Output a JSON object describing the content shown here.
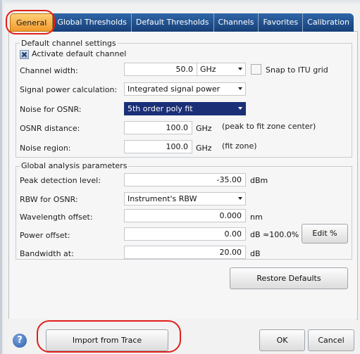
{
  "tabs": [
    {
      "label": "General"
    },
    {
      "label": "Global Thresholds"
    },
    {
      "label": "Default Thresholds"
    },
    {
      "label": "Channels"
    },
    {
      "label": "Favorites"
    },
    {
      "label": "Calibration"
    }
  ],
  "default_channel": {
    "title": "Default channel settings",
    "activate_label": "Activate default channel",
    "activate_checked": true,
    "channel_width": {
      "label": "Channel width:",
      "value": "50.0",
      "unit": "GHz"
    },
    "snap_label": "Snap to ITU grid",
    "snap_checked": false,
    "signal_power": {
      "label": "Signal power calculation:",
      "value": "Integrated signal power"
    },
    "noise_osnr": {
      "label": "Noise for OSNR:",
      "value": "5th order poly fit"
    },
    "osnr_distance": {
      "label": "OSNR distance:",
      "value": "100.0",
      "unit": "GHz",
      "note": "(peak to fit zone center)"
    },
    "noise_region": {
      "label": "Noise region:",
      "value": "100.0",
      "unit": "GHz",
      "note": "(fit zone)"
    }
  },
  "global_analysis": {
    "title": "Global analysis parameters",
    "peak_detection": {
      "label": "Peak detection level:",
      "value": "-35.00",
      "unit": "dBm"
    },
    "rbw": {
      "label": "RBW for OSNR:",
      "value": "Instrument's RBW"
    },
    "wavelength_offset": {
      "label": "Wavelength offset:",
      "value": "0.000",
      "unit": "nm"
    },
    "power_offset": {
      "label": "Power offset:",
      "value": "0.00",
      "unit": "dB ≈100.0%",
      "edit_label": "Edit %"
    },
    "bandwidth": {
      "label": "Bandwidth at:",
      "value": "20.00",
      "unit": "dB"
    }
  },
  "restore_label": "Restore Defaults",
  "bottom": {
    "help_glyph": "?",
    "import_label": "Import from Trace",
    "ok_label": "OK",
    "cancel_label": "Cancel"
  },
  "highlight_color": "#e0201b"
}
